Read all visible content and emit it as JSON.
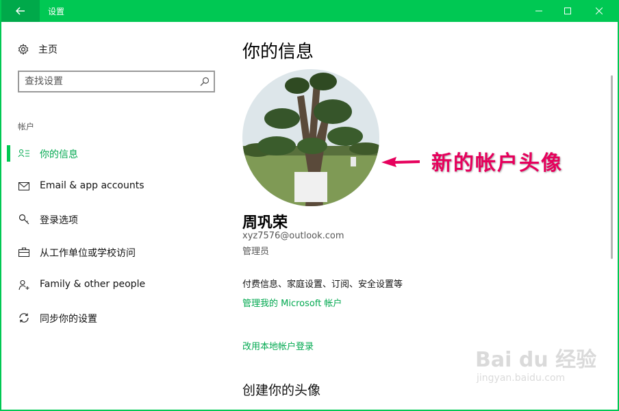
{
  "window": {
    "title": "设置"
  },
  "sidebar": {
    "home_label": "主页",
    "search_placeholder": "查找设置",
    "section_label": "帐户",
    "items": [
      {
        "label": "你的信息",
        "icon": "person-info-icon",
        "active": true
      },
      {
        "label": "Email & app accounts",
        "icon": "mail-icon"
      },
      {
        "label": "登录选项",
        "icon": "key-icon"
      },
      {
        "label": "从工作单位或学校访问",
        "icon": "briefcase-icon"
      },
      {
        "label": "Family & other people",
        "icon": "person-add-icon"
      },
      {
        "label": "同步你的设置",
        "icon": "sync-icon"
      }
    ]
  },
  "main": {
    "title": "你的信息",
    "annotation": "新的帐户头像",
    "user_name": "周巩荣",
    "email": "xyz7576@outlook.com",
    "role": "管理员",
    "billing_text": "付费信息、家庭设置、订阅、安全设置等",
    "manage_link": "管理我的 Microsoft 帐户",
    "local_link": "改用本地帐户登录",
    "avatar_heading": "创建你的头像"
  },
  "watermark": {
    "brand": "Bai du 经验",
    "url": "jingyan.baidu.com"
  },
  "colors": {
    "accent": "#00c853",
    "accent_text": "#00a84f",
    "annotation": "#e6005c"
  }
}
